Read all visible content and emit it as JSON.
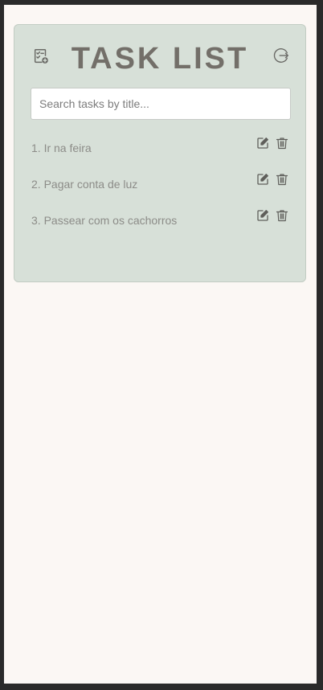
{
  "app": {
    "title": "TASK LIST"
  },
  "header": {
    "add_icon": "add-task-icon",
    "logout_icon": "logout-icon"
  },
  "search": {
    "placeholder": "Search tasks by title...",
    "value": ""
  },
  "tasks": [
    {
      "label": "1. Ir na feira"
    },
    {
      "label": "2. Pagar conta de luz"
    },
    {
      "label": "3. Passear com os cachorros"
    }
  ],
  "colors": {
    "page_background": "#fbf7f4",
    "card_background": "#d7e0d8",
    "title": "#736f69",
    "task_text": "#8c8c88",
    "icon": "#6a6a66"
  }
}
